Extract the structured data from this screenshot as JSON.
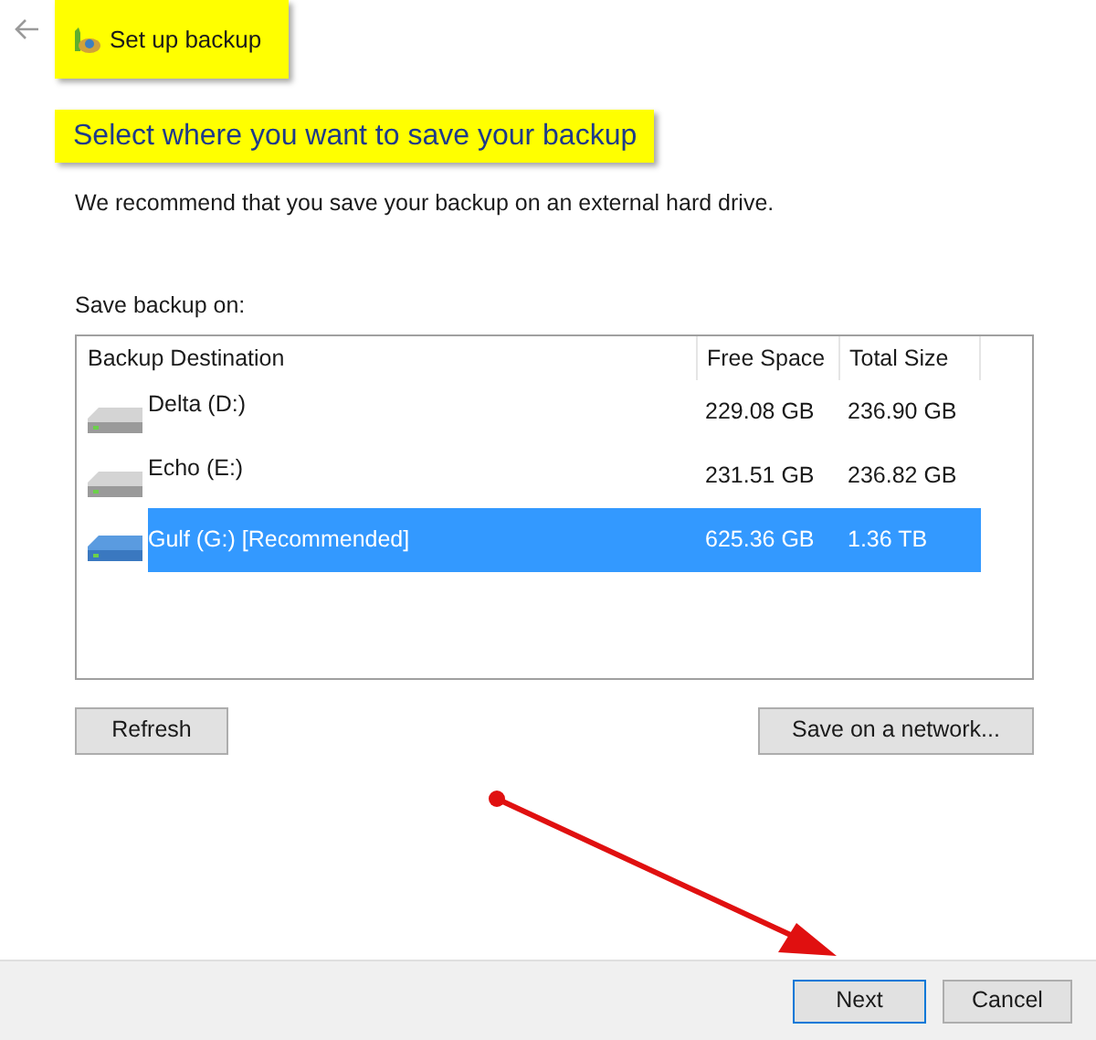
{
  "header": {
    "title": "Set up backup"
  },
  "heading": "Select where you want to save your backup",
  "description": "We recommend that you save your backup on an external hard drive.",
  "list_label": "Save backup on:",
  "table": {
    "columns": [
      "Backup Destination",
      "Free Space",
      "Total Size"
    ],
    "rows": [
      {
        "name": "Delta (D:)",
        "free": "229.08 GB",
        "total": "236.90 GB",
        "selected": false
      },
      {
        "name": "Echo (E:)",
        "free": "231.51 GB",
        "total": "236.82 GB",
        "selected": false
      },
      {
        "name": "Gulf (G:) [Recommended]",
        "free": "625.36 GB",
        "total": "1.36 TB",
        "selected": true
      }
    ]
  },
  "buttons": {
    "refresh": "Refresh",
    "network": "Save on a network..."
  },
  "footer": {
    "next": "Next",
    "cancel": "Cancel"
  }
}
